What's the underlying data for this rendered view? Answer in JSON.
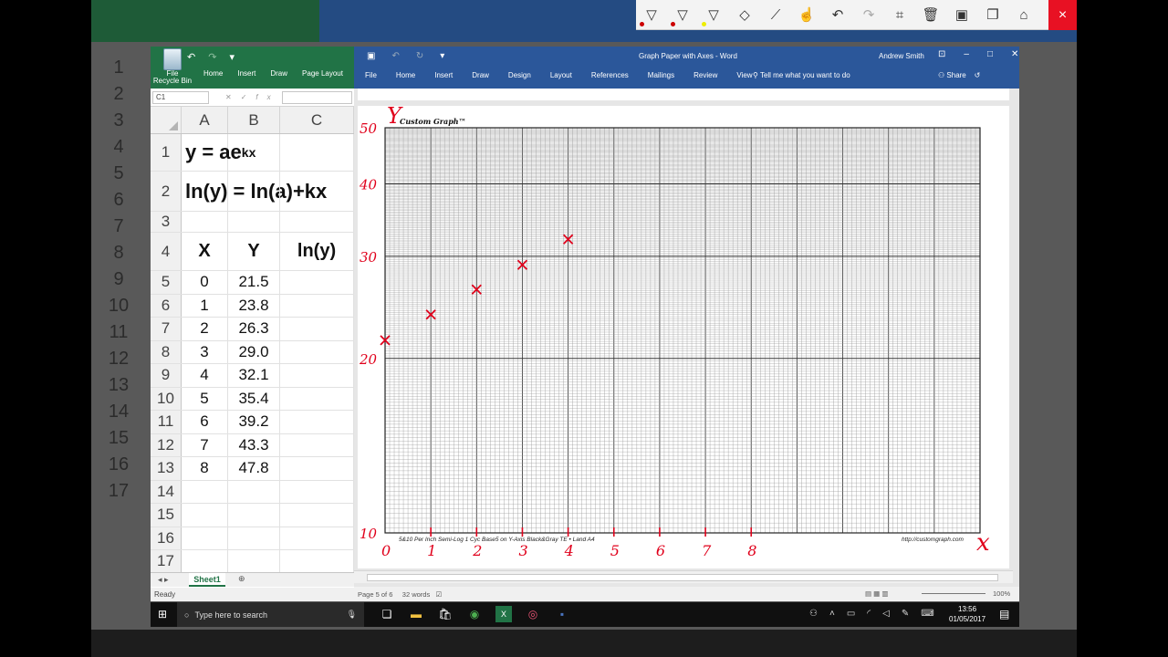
{
  "background": {
    "row_numbers": [
      "1",
      "2",
      "3",
      "4",
      "5",
      "6",
      "7",
      "8",
      "9",
      "10",
      "11",
      "12",
      "13",
      "14",
      "15",
      "16",
      "17"
    ],
    "taskbar_search": "Type here to search",
    "clock_time": "13:56",
    "clock_date": "01/05/2017",
    "status": "Ready"
  },
  "ink_toolbar": {
    "close_icon": "×"
  },
  "excel": {
    "recycle_bin_label": "File\nRecycle Bin",
    "tabs": [
      "Home",
      "Insert",
      "Draw",
      "Page Layout"
    ],
    "name_box": "C1",
    "columns": [
      "A",
      "B",
      "C"
    ],
    "rows": [
      {
        "num": "1",
        "a": "y = ae",
        "sup": "kx"
      },
      {
        "num": "2",
        "a": "ln(y) = ln(a)+kx"
      },
      {
        "num": "3",
        "a": ""
      },
      {
        "num": "4",
        "a": "X",
        "b": "Y",
        "c": "ln(y)"
      },
      {
        "num": "5",
        "a": "0",
        "b": "21.5"
      },
      {
        "num": "6",
        "a": "1",
        "b": "23.8"
      },
      {
        "num": "7",
        "a": "2",
        "b": "26.3"
      },
      {
        "num": "8",
        "a": "3",
        "b": "29.0"
      },
      {
        "num": "9",
        "a": "4",
        "b": "32.1"
      },
      {
        "num": "10",
        "a": "5",
        "b": "35.4"
      },
      {
        "num": "11",
        "a": "6",
        "b": "39.2"
      },
      {
        "num": "12",
        "a": "7",
        "b": "43.3"
      },
      {
        "num": "13",
        "a": "8",
        "b": "47.8"
      },
      {
        "num": "14"
      },
      {
        "num": "15"
      },
      {
        "num": "16"
      },
      {
        "num": "17"
      }
    ],
    "sheet_tab": "Sheet1",
    "status": "Ready"
  },
  "word": {
    "title": "Graph Paper with Axes  -  Word",
    "user": "Andrew Smith",
    "tabs": [
      "File",
      "Home",
      "Insert",
      "Draw",
      "Design",
      "Layout",
      "References",
      "Mailings",
      "Review",
      "View"
    ],
    "tell_me": "Tell me what you want to do",
    "share": "Share",
    "status_page": "Page 5 of 6",
    "status_words": "32 words",
    "zoom": "100%",
    "graph": {
      "brand": "Custom Graph™",
      "footer_left": "5&10 Per Inch Semi-Log 1 Cyc Base5 on Y-Axis Black&Gray TE • Land A4",
      "footer_right": "http://customgraph.com",
      "hand_y_label": "Y",
      "hand_x_label": "x",
      "hand_y_ticks": [
        "50",
        "40",
        "30",
        "20",
        "10"
      ],
      "hand_x_ticks": [
        "0",
        "1",
        "2",
        "3",
        "4",
        "5",
        "6",
        "7",
        "8"
      ],
      "points": [
        {
          "x": 0,
          "y": 21.5
        },
        {
          "x": 1,
          "y": 23.8
        },
        {
          "x": 2,
          "y": 26.3
        },
        {
          "x": 3,
          "y": 29.0
        },
        {
          "x": 4,
          "y": 32.1
        }
      ]
    }
  },
  "taskbar": {
    "search": "Type here to search",
    "time": "13:56",
    "date": "01/05/2017"
  }
}
